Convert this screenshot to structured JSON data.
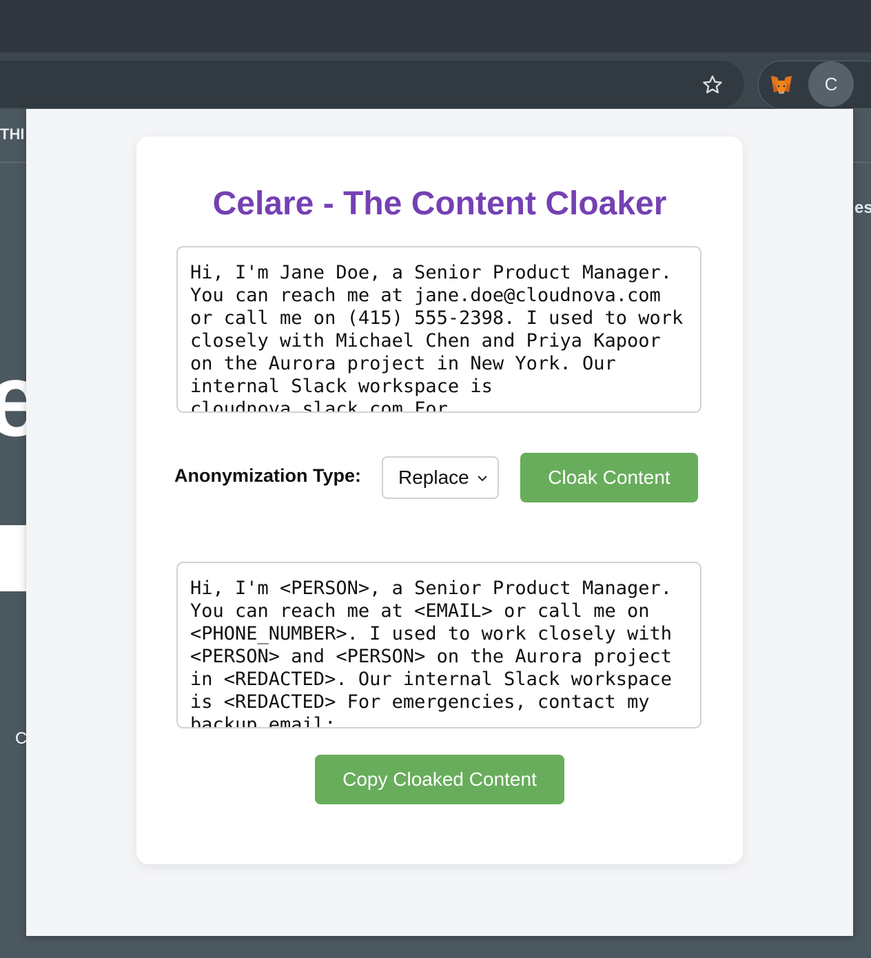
{
  "browser": {
    "avatar_letter": "C",
    "background_texts": {
      "top_left": "THI",
      "right": "es",
      "left_letter": "e",
      "left_bottom": "C"
    }
  },
  "app": {
    "title": "Celare - The Content Cloaker",
    "input_text": "Hi, I'm Jane Doe, a Senior Product Manager. You can reach me at jane.doe@cloudnova.com or call me on (415) 555-2398. I used to work closely with Michael Chen and Priya Kapoor on the Aurora project in New York. Our internal Slack workspace is cloudnova.slack.com For",
    "anonymization_label": "Anonymization Type:",
    "anonymization_selected": "Replace",
    "cloak_button": "Cloak Content",
    "output_text": "Hi, I'm <PERSON>, a Senior Product Manager. You can reach me at <EMAIL> or call me on <PHONE_NUMBER>. I used to work closely with <PERSON> and <PERSON> on the Aurora project in <REDACTED>. Our internal Slack workspace is <REDACTED> For emergencies, contact my backup email:",
    "copy_button": "Copy Cloaked Content"
  },
  "colors": {
    "title": "#7540b3",
    "button": "#68ad5c"
  },
  "icons": {
    "bookmark": "star-icon",
    "extension": "metamask-fox-icon",
    "select": "chevron-down-icon"
  }
}
